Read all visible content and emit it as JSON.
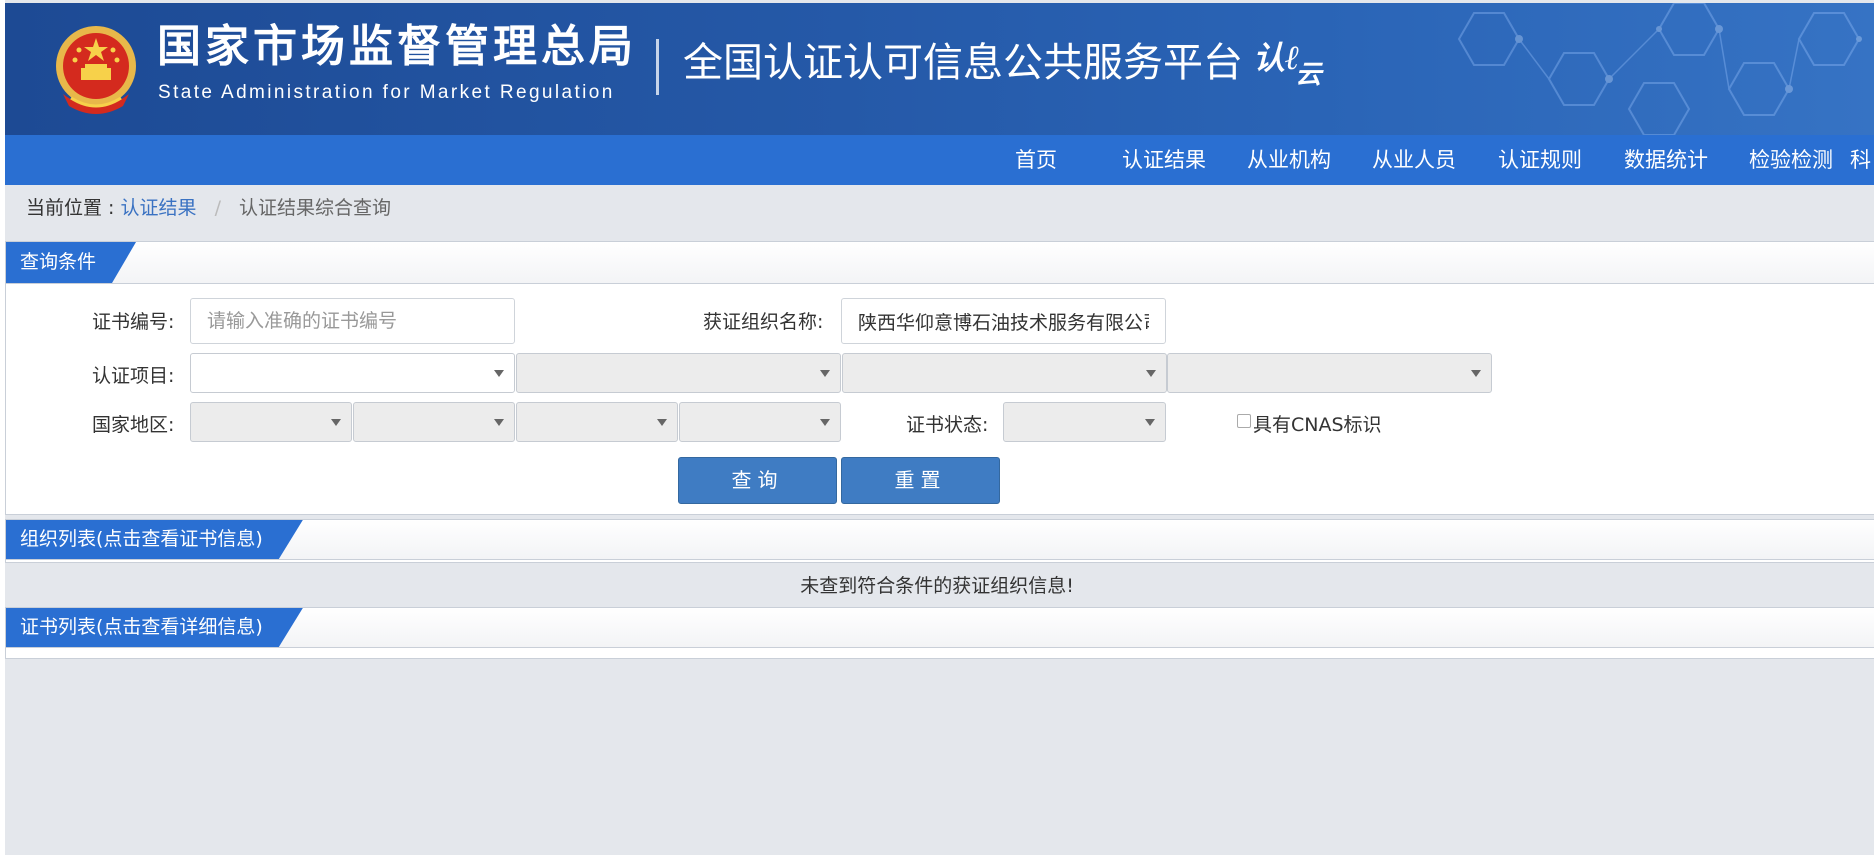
{
  "header": {
    "title_cn": "国家市场监督管理总局",
    "title_en": "State Administration  for  Market Regulation",
    "platform_title": "全国认证认可信息公共服务平台",
    "logo_mark": "认",
    "logo_sub": "云"
  },
  "nav": {
    "items": [
      "首页",
      "认证结果",
      "从业机构",
      "从业人员",
      "认证规则",
      "数据统计",
      "检验检测",
      "科"
    ]
  },
  "breadcrumb": {
    "label": "当前位置 :",
    "link": "认证结果",
    "separator": "/",
    "current": "认证结果综合查询"
  },
  "query_panel": {
    "title": "查询条件",
    "cert_no_label": "证书编号:",
    "cert_no_placeholder": "请输入准确的证书编号",
    "cert_no_value": "",
    "org_name_label": "获证组织名称:",
    "org_name_value": "陕西华仰意博石油技术服务有限公司",
    "project_label": "认证项目:",
    "region_label": "国家地区:",
    "status_label": "证书状态:",
    "cnas_label": "具有CNAS标识",
    "search_button": "查询",
    "reset_button": "重置"
  },
  "org_panel": {
    "title": "组织列表(点击查看证书信息)",
    "empty_message": "未查到符合条件的获证组织信息!"
  },
  "cert_panel": {
    "title": "证书列表(点击查看详细信息)"
  },
  "colors": {
    "nav_blue": "#2a6fd2",
    "button_blue": "#3f7cc3",
    "header_blue": "#1d4a94",
    "link_blue": "#3a72c2"
  },
  "icons": [
    "national-emblem-icon",
    "caret-down-icon",
    "hexagon-pattern-decoration"
  ]
}
